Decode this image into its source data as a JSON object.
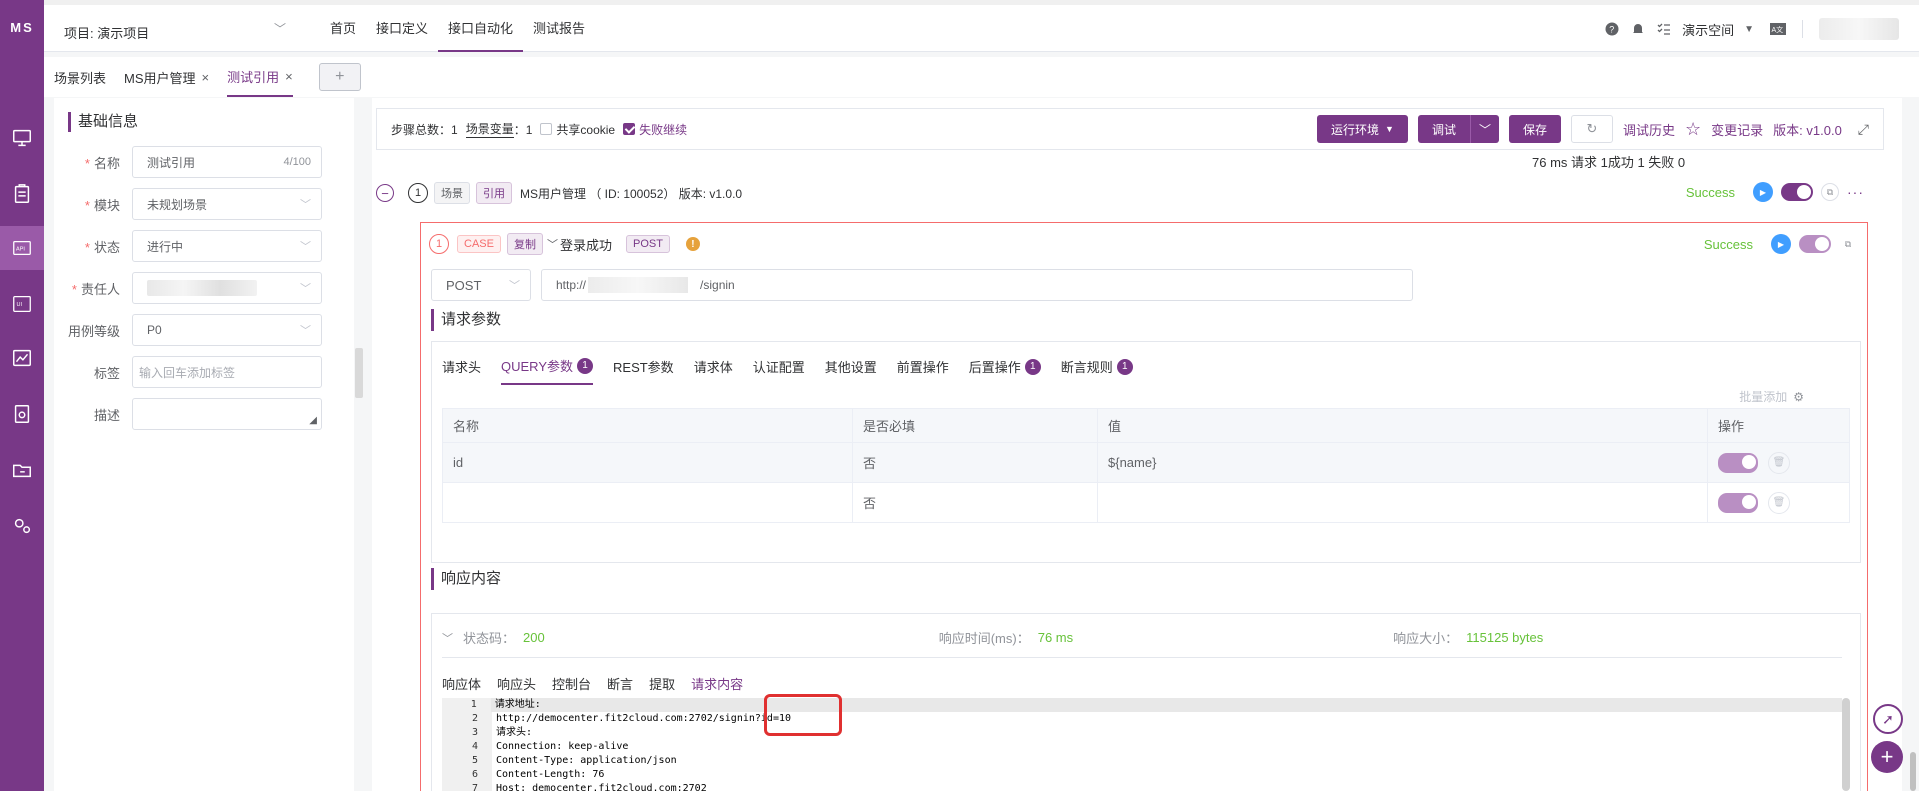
{
  "logo": "MS",
  "nav_rail": [
    "monitor-icon",
    "clipboard-icon",
    "api-icon",
    "ui-icon",
    "chart-icon",
    "report-icon",
    "folder-icon",
    "settings-icon"
  ],
  "header": {
    "project": "项目: 演示项目",
    "menu": [
      "首页",
      "接口定义",
      "接口自动化",
      "测试报告"
    ],
    "workspace": "演示空间"
  },
  "tabs": {
    "items": [
      "场景列表",
      "MS用户管理",
      "测试引用"
    ],
    "add": "+"
  },
  "form": {
    "title": "基础信息",
    "name_label": "名称",
    "name_value": "测试引用",
    "name_count": "4/100",
    "module_label": "模块",
    "module_value": "未规划场景",
    "status_label": "状态",
    "status_value": "进行中",
    "owner_label": "责任人",
    "level_label": "用例等级",
    "level_value": "P0",
    "tags_label": "标签",
    "tags_placeholder": "输入回车添加标签",
    "desc_label": "描述"
  },
  "summary": {
    "steps": "步骤总数：1",
    "vars_label": "场景变量",
    "vars_count": "：1",
    "share_cookie": "共享cookie",
    "fail_continue": "失败继续",
    "run_env": "运行环境",
    "debug": "调试",
    "save": "保存",
    "debug_history": "调试历史",
    "change_log": "变更记录",
    "version": "版本: v1.0.0",
    "result": "76 ms 请求 1成功 1 失败 0"
  },
  "scene": {
    "index": "1",
    "tag_scene": "场景",
    "tag_ref": "引用",
    "title": "MS用户管理 （ ID: 100052） 版本: v1.0.0",
    "status": "Success"
  },
  "case": {
    "index": "1",
    "tag_case": "CASE",
    "tag_copy": "复制",
    "name": "登录成功",
    "method_tag": "POST",
    "status": "Success",
    "method": "POST",
    "url_prefix": "http://",
    "url_path": "/signin",
    "req_title": "请求参数",
    "req_tabs": [
      {
        "label": "请求头"
      },
      {
        "label": "QUERY参数",
        "badge": "1"
      },
      {
        "label": "REST参数"
      },
      {
        "label": "请求体"
      },
      {
        "label": "认证配置"
      },
      {
        "label": "其他设置"
      },
      {
        "label": "前置操作"
      },
      {
        "label": "后置操作",
        "badge": "1"
      },
      {
        "label": "断言规则",
        "badge": "1"
      }
    ],
    "bulk_add": "批量添加",
    "table": {
      "headers": [
        "名称",
        "是否必填",
        "值",
        "操作"
      ],
      "rows": [
        [
          "id",
          "否",
          "${name}"
        ],
        [
          "",
          "否",
          ""
        ]
      ]
    },
    "resp_title": "响应内容",
    "status_code_label": "状态码：",
    "status_code": "200",
    "resp_time_label": "响应时间(ms)：",
    "resp_time": "76 ms",
    "resp_size_label": "响应大小：",
    "resp_size": "115125 bytes",
    "resp_tabs": [
      "响应体",
      "响应头",
      "控制台",
      "断言",
      "提取",
      "请求内容"
    ],
    "code": [
      "请求地址:",
      "http://democenter.fit2cloud.com:2702/signin?id=10",
      "请求头:",
      "Connection: keep-alive",
      "Content-Type: application/json",
      "Content-Length: 76",
      "Host: democenter.fit2cloud.com:2702"
    ]
  }
}
